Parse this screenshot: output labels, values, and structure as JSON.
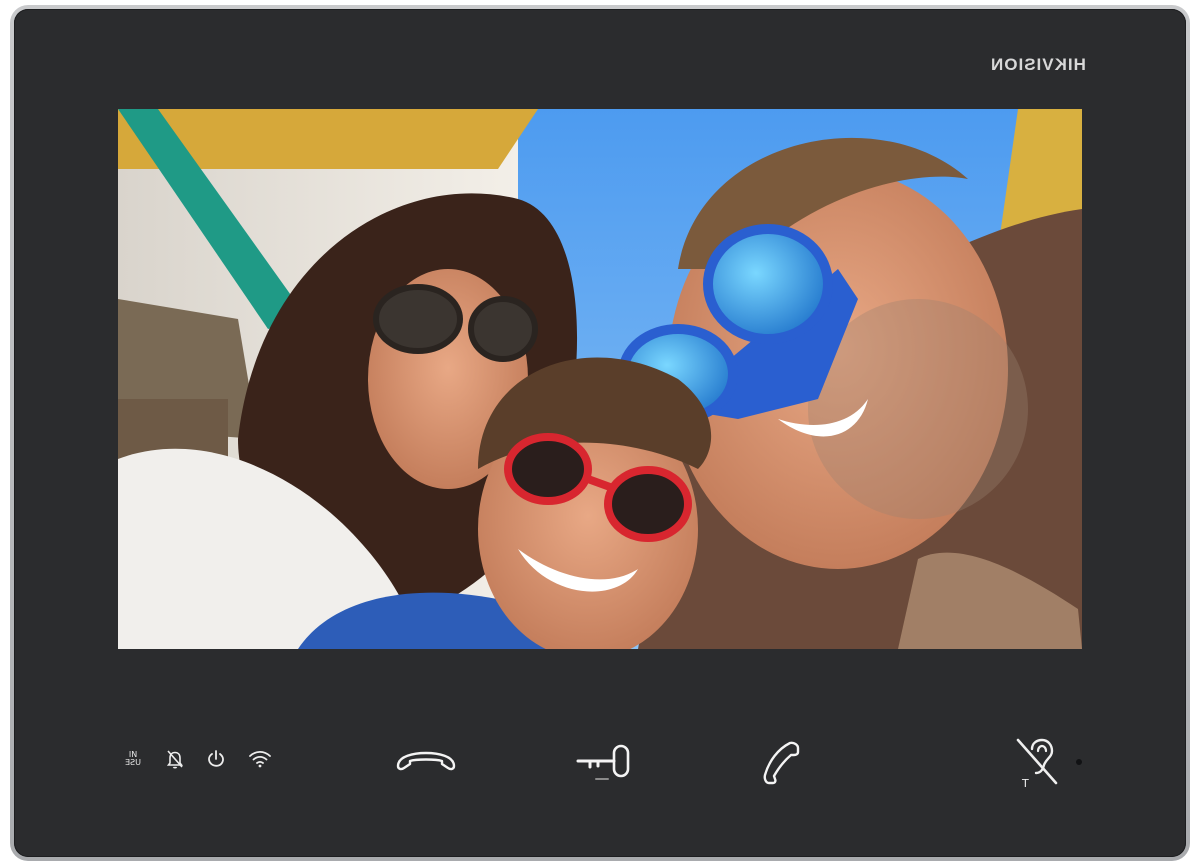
{
  "brand": {
    "logo_text": "HIKVISION"
  },
  "screen": {
    "content": "live-video-feed",
    "image_subject": "family selfie"
  },
  "status_indicators": [
    {
      "name": "in-use",
      "top_text": "IN",
      "bottom_text": "USE"
    },
    {
      "name": "mute-icon"
    },
    {
      "name": "power-icon"
    },
    {
      "name": "wifi-icon"
    }
  ],
  "controls": {
    "hangup": {
      "icon": "hangup-icon"
    },
    "unlock": {
      "icon": "key-icon"
    },
    "answer": {
      "icon": "phone-icon"
    }
  },
  "accessibility": {
    "icon": "hearing-loop-icon",
    "label": "T"
  },
  "colors": {
    "bezel": "#2b2c2e",
    "frame": "#b8babd",
    "icon": "#f2f2f2",
    "logo": "#d8d8d8"
  }
}
